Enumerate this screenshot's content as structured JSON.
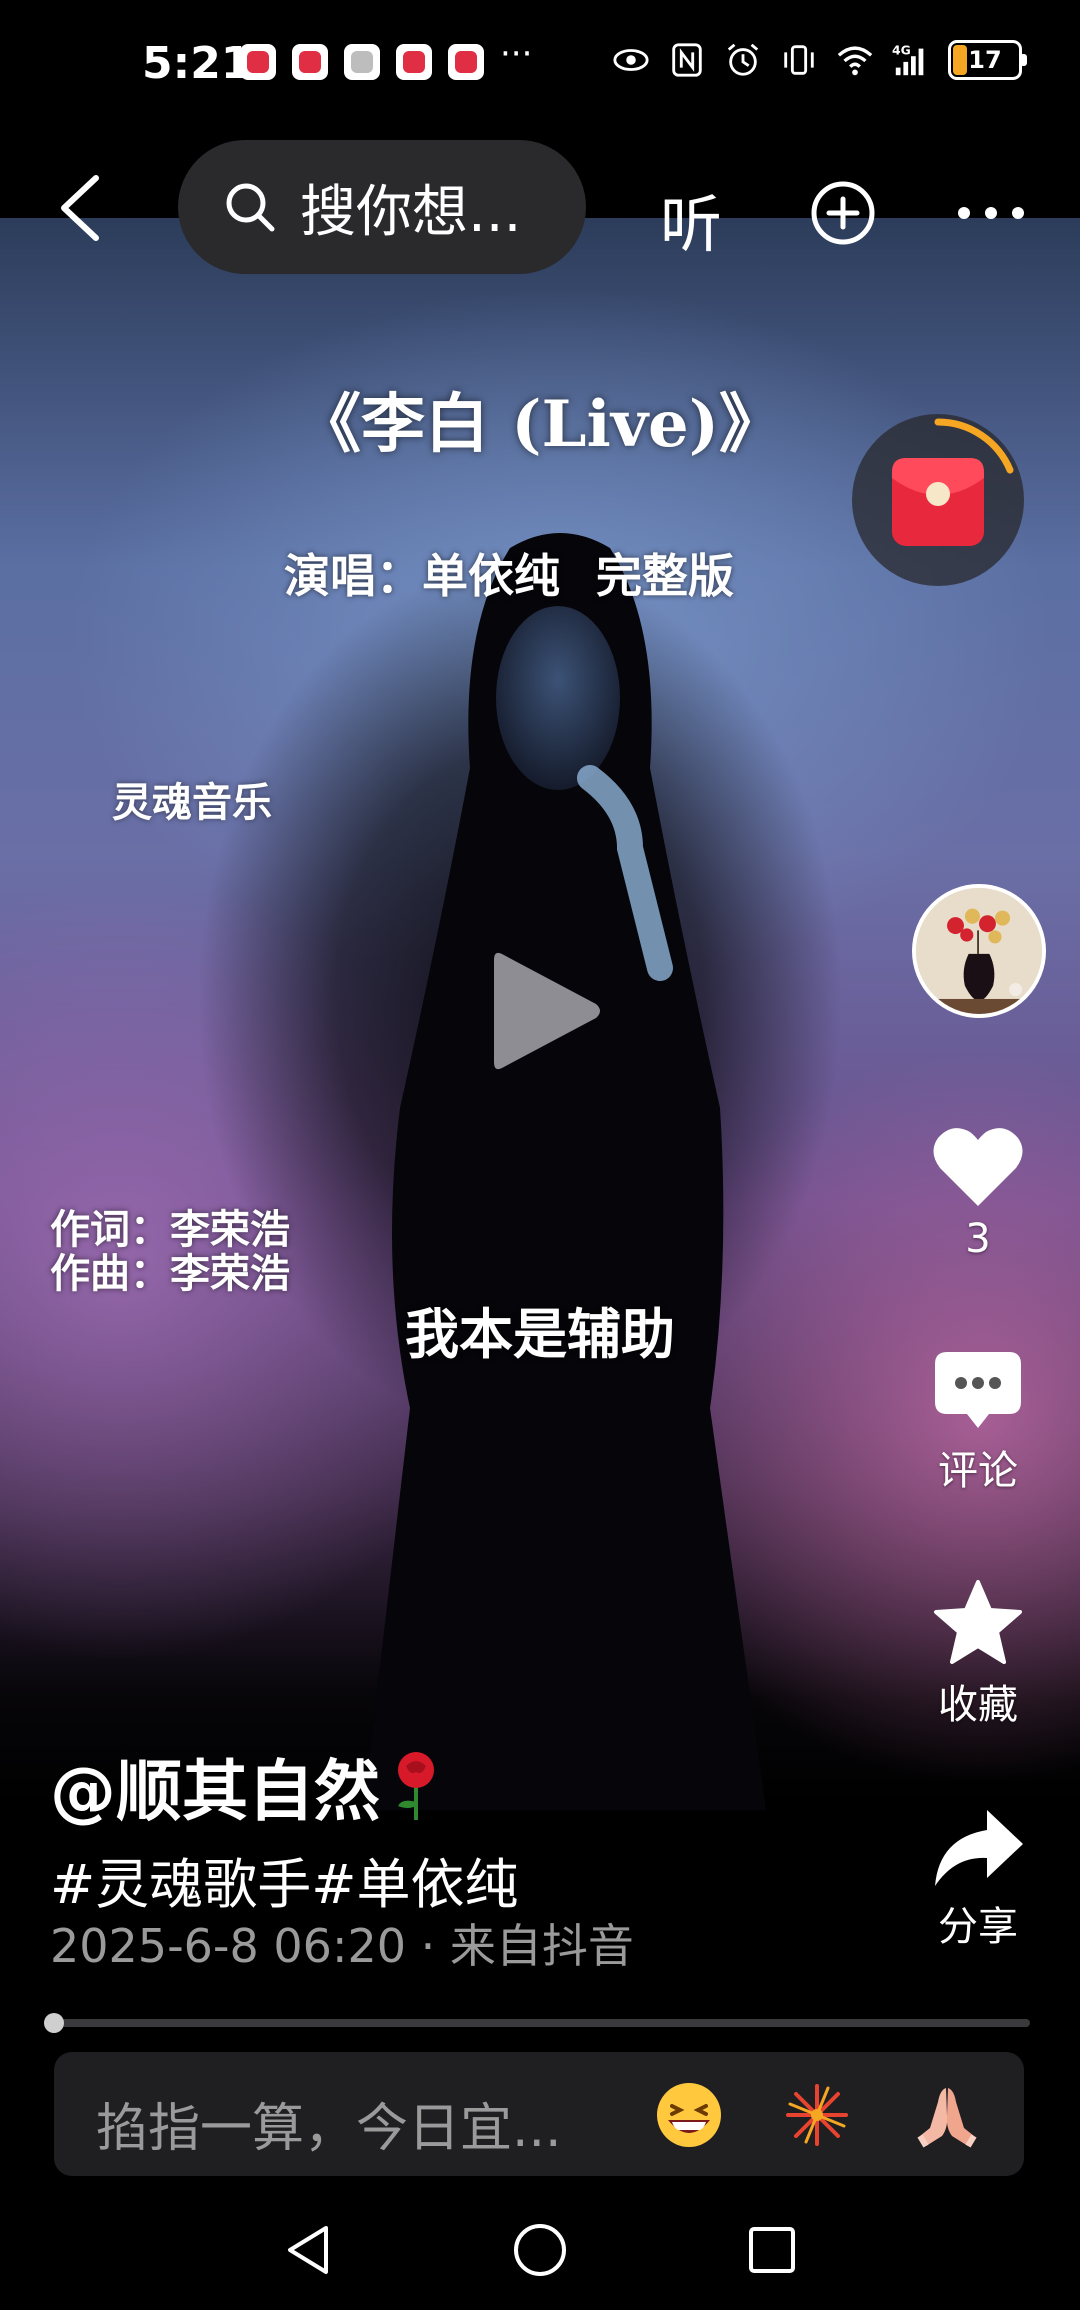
{
  "status_bar": {
    "time": "5:21",
    "more": "···",
    "battery": "17"
  },
  "top_nav": {
    "search_placeholder": "搜你想...",
    "listen_label": "听"
  },
  "video": {
    "title": "《李白 (Live)》",
    "subtitle": "演唱：单依纯 完整版",
    "watermark": "灵魂音乐",
    "lyricist": "作词：李荣浩",
    "composer": "作曲：李荣浩",
    "lyric": "我本是辅助"
  },
  "actions": {
    "like_count": "3",
    "comment_label": "评论",
    "favorite_label": "收藏",
    "share_label": "分享"
  },
  "post": {
    "author": "@顺其自然",
    "hashtags": "#灵魂歌手#单依纯",
    "meta": "2025-6-8 06:20 · 来自抖音"
  },
  "comment_bar": {
    "placeholder": "掐指一算，今日宜..."
  },
  "colors": {
    "accent_orange": "#f5a623",
    "red_packet": "#e8283c",
    "comment_bar_bg": "#1f1f22"
  }
}
